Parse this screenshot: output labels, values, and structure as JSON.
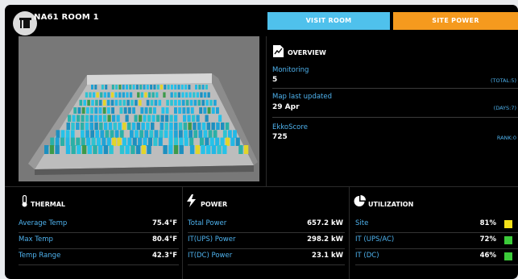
{
  "header": {
    "room_title": "NA61 ROOM 1",
    "visit_label": "VISIT ROOM",
    "site_power_label": "SITE POWER"
  },
  "overview": {
    "title": "OVERVIEW",
    "items": [
      {
        "label": "Monitoring",
        "value": "5",
        "right": "(TOTAL:5)"
      },
      {
        "label": "Map last updated",
        "value": "29 Apr",
        "right": "(DAYS:7)"
      },
      {
        "label": "EkkoScore",
        "value": "725",
        "right": "RANK:0"
      }
    ]
  },
  "thermal": {
    "title": "THERMAL",
    "rows": [
      {
        "label": "Average Temp",
        "value": "75.4°F"
      },
      {
        "label": "Max Temp",
        "value": "80.4°F"
      },
      {
        "label": "Temp Range",
        "value": "42.3°F"
      }
    ]
  },
  "power": {
    "title": "POWER",
    "rows": [
      {
        "label": "Total Power",
        "value": "657.2 kW"
      },
      {
        "label": "IT(UPS) Power",
        "value": "298.2 kW"
      },
      {
        "label": "IT(DC) Power",
        "value": "23.1 kW"
      }
    ]
  },
  "utilization": {
    "title": "UTILIZATION",
    "rows": [
      {
        "label": "Site",
        "value": "81%",
        "status": "#f5e11a"
      },
      {
        "label": "IT (UPS/AC)",
        "value": "72%",
        "status": "#3ccb3a"
      },
      {
        "label": "IT (DC)",
        "value": "46%",
        "status": "#3ccb3a"
      }
    ]
  },
  "colors": {
    "accent_blue": "#4fc1ec",
    "accent_orange": "#f59a1e",
    "label_blue": "#4fb3ef"
  },
  "icons": [
    "building-icon",
    "document-chart-icon",
    "thermometer-icon",
    "lightning-icon",
    "pie-chart-icon"
  ]
}
